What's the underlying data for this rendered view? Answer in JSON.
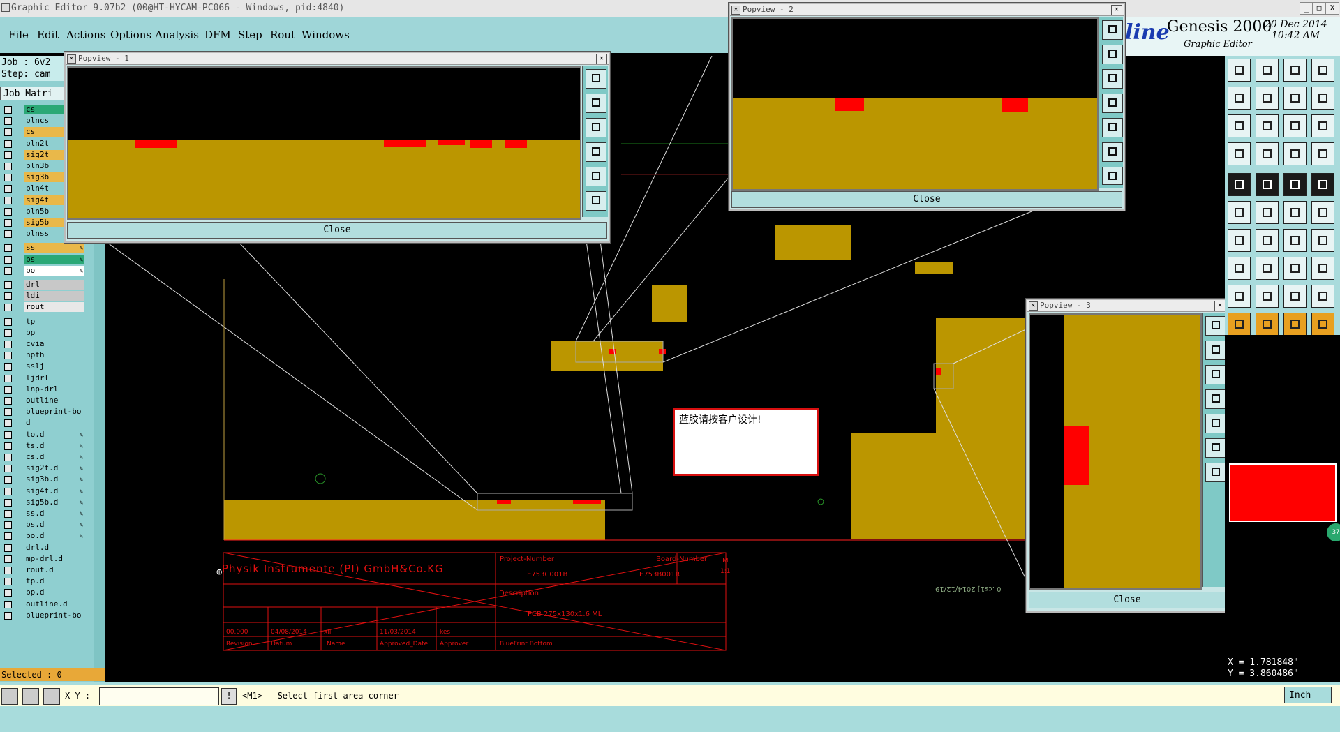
{
  "window": {
    "title": "Graphic Editor 9.07b2 (00@HT-HYCAM-PC066 - Windows, pid:4840)",
    "buttons": [
      "_",
      "□",
      "X"
    ]
  },
  "menu": {
    "items": [
      "File",
      "Edit",
      "Actions",
      "Options",
      "Analysis",
      "DFM",
      "Step",
      "Rout",
      "Windows"
    ]
  },
  "brand": {
    "logo_fragment": "line",
    "product": "Genesis 2000",
    "subtitle": "Graphic Editor",
    "date": "20 Dec 2014",
    "time": "10:42 AM"
  },
  "job": {
    "job_label": "Job : 6v2",
    "step_label": "Step: cam",
    "matrix_label": "Job Matri",
    "selected": "Selected : 0"
  },
  "layers": [
    {
      "name": "cs",
      "color": "#2aa876",
      "pen": false
    },
    {
      "name": "plncs",
      "color": "#8fcfd0",
      "pen": false
    },
    {
      "name": "cs",
      "color": "#e9b84a",
      "pen": false
    },
    {
      "name": "pln2t",
      "color": "#8fcfd0",
      "pen": false
    },
    {
      "name": "sig2t",
      "color": "#e9b84a",
      "pen": false
    },
    {
      "name": "pln3b",
      "color": "#8fcfd0",
      "pen": false
    },
    {
      "name": "sig3b",
      "color": "#e9b84a",
      "pen": false
    },
    {
      "name": "pln4t",
      "color": "#8fcfd0",
      "pen": false
    },
    {
      "name": "sig4t",
      "color": "#e9b84a",
      "pen": false
    },
    {
      "name": "pln5b",
      "color": "#8fcfd0",
      "pen": false
    },
    {
      "name": "sig5b",
      "color": "#e9b84a",
      "pen": true
    },
    {
      "name": "plnss",
      "color": "#8fcfd0",
      "pen": false
    },
    {
      "name": "ss",
      "color": "#e9b84a",
      "pen": true
    },
    {
      "name": "bs",
      "color": "#2aa876",
      "pen": true
    },
    {
      "name": "bo",
      "color": "#ffffff",
      "pen": true
    },
    {
      "name": "drl",
      "color": "#c8c8c8",
      "pen": false
    },
    {
      "name": "ldi",
      "color": "#c8c8c8",
      "pen": false
    },
    {
      "name": "rout",
      "color": "#e8e8e8",
      "pen": false
    },
    {
      "name": "tp",
      "color": "#8fcfd0",
      "pen": false
    },
    {
      "name": "bp",
      "color": "#8fcfd0",
      "pen": false
    },
    {
      "name": "cvia",
      "color": "#8fcfd0",
      "pen": false
    },
    {
      "name": "npth",
      "color": "#8fcfd0",
      "pen": false
    },
    {
      "name": "sslj",
      "color": "#8fcfd0",
      "pen": false
    },
    {
      "name": "ljdrl",
      "color": "#8fcfd0",
      "pen": false
    },
    {
      "name": "lnp-drl",
      "color": "#8fcfd0",
      "pen": false
    },
    {
      "name": "outline",
      "color": "#8fcfd0",
      "pen": false
    },
    {
      "name": "blueprint-bo",
      "color": "#8fcfd0",
      "pen": false
    },
    {
      "name": "d",
      "color": "#8fcfd0",
      "pen": false
    },
    {
      "name": "to.d",
      "color": "#8fcfd0",
      "pen": true
    },
    {
      "name": "ts.d",
      "color": "#8fcfd0",
      "pen": true
    },
    {
      "name": "cs.d",
      "color": "#8fcfd0",
      "pen": true
    },
    {
      "name": "sig2t.d",
      "color": "#8fcfd0",
      "pen": true
    },
    {
      "name": "sig3b.d",
      "color": "#8fcfd0",
      "pen": true
    },
    {
      "name": "sig4t.d",
      "color": "#8fcfd0",
      "pen": true
    },
    {
      "name": "sig5b.d",
      "color": "#8fcfd0",
      "pen": true
    },
    {
      "name": "ss.d",
      "color": "#8fcfd0",
      "pen": true
    },
    {
      "name": "bs.d",
      "color": "#8fcfd0",
      "pen": true
    },
    {
      "name": "bo.d",
      "color": "#8fcfd0",
      "pen": true
    },
    {
      "name": "drl.d",
      "color": "#8fcfd0",
      "pen": false
    },
    {
      "name": "mp-drl.d",
      "color": "#8fcfd0",
      "pen": false
    },
    {
      "name": "rout.d",
      "color": "#8fcfd0",
      "pen": false
    },
    {
      "name": "tp.d",
      "color": "#8fcfd0",
      "pen": false
    },
    {
      "name": "bp.d",
      "color": "#8fcfd0",
      "pen": false
    },
    {
      "name": "outline.d",
      "color": "#8fcfd0",
      "pen": false
    },
    {
      "name": "blueprint-bo",
      "color": "#8fcfd0",
      "pen": false
    }
  ],
  "popviews": [
    {
      "title": "Popview - 1",
      "close_label": "Close"
    },
    {
      "title": "Popview - 2",
      "close_label": "Close"
    },
    {
      "title": "Popview - 3",
      "close_label": "Close"
    }
  ],
  "note": {
    "text": "蓝胶请按客户设计!"
  },
  "titleblock": {
    "company": "Physik Instrumente (PI) GmbH&Co.KG",
    "project_label": "Project-Number",
    "board_label": "Board-Number",
    "project_number": "E753C001B",
    "board_number": "E753B001R",
    "m_label": "M",
    "sheet": "1:1",
    "description_label": "Description",
    "description": "PCB 275x130x1.6 ML",
    "row_values": [
      "00.000",
      "04/08/2014",
      "xll",
      "11/03/2014",
      "kes"
    ],
    "headers": [
      "Revision",
      "Datum",
      "Name",
      "Approved_Date",
      "Approver",
      "BlueFrint Bottom"
    ],
    "side_text": "0 .cs1] 2014/12/19"
  },
  "status": {
    "xy_label": "X Y :",
    "xy_value": "",
    "prompt": "<M1> - Select first area corner",
    "units": "Inch",
    "x_readout": "X = 1.781848\"",
    "y_readout": "Y = 3.860486\""
  },
  "colors": {
    "copper": "#bb9600",
    "pad": "#ff0000",
    "panel": "#8fcfd0"
  }
}
